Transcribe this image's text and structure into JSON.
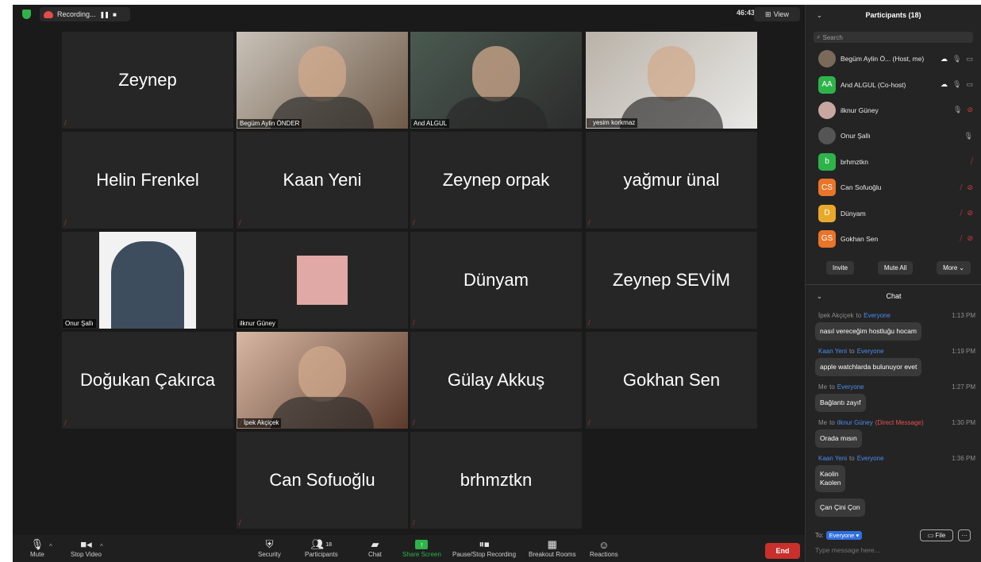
{
  "topbar": {
    "recording_label": "Recording...",
    "pause_glyph": "❚❚",
    "stop_glyph": "■",
    "timer": "46:43",
    "view_label": "View"
  },
  "tiles": [
    {
      "name": "Zeynep",
      "muted": true
    },
    {
      "name": "Begüm Aylin ÖNDER",
      "video": true
    },
    {
      "name": "And ALGUL",
      "video": true,
      "active": true
    },
    {
      "name": "yesim korkmaz",
      "video": true,
      "muted": true
    },
    {
      "name": "Helin Frenkel",
      "muted": true
    },
    {
      "name": "Kaan Yeni",
      "muted": true
    },
    {
      "name": "Zeynep orpak",
      "muted": true
    },
    {
      "name": "yağmur ünal",
      "muted": true
    },
    {
      "name": "Onur Şallı",
      "video": true
    },
    {
      "name": "ilknur Güney",
      "video": true
    },
    {
      "name": "Dünyam",
      "muted": true
    },
    {
      "name": "Zeynep SEVİM",
      "muted": true
    },
    {
      "name": "Doğukan Çakırca",
      "muted": true
    },
    {
      "name": "İpek Akçiçek",
      "video": true,
      "muted": true
    },
    {
      "name": "Gülay Akkuş",
      "muted": true
    },
    {
      "name": "Gokhan Sen",
      "muted": true
    },
    {
      "name": "Can Sofuoğlu",
      "muted": true
    },
    {
      "name": "brhmztkn",
      "muted": true
    }
  ],
  "toolbar": {
    "mute": "Mute",
    "stop_video": "Stop Video",
    "security": "Security",
    "participants": "Participants",
    "participants_count": "18",
    "chat": "Chat",
    "share_screen": "Share Screen",
    "pause_stop_recording": "Pause/Stop Recording",
    "breakout_rooms": "Breakout Rooms",
    "reactions": "Reactions",
    "end": "End"
  },
  "participants_panel": {
    "title": "Participants (18)",
    "search_placeholder": "Search",
    "list": [
      {
        "name": "Begüm Aylin Ö... (Host, me)",
        "avatar_text": "",
        "avatar_color": "#7a6a5a",
        "icons": [
          "cloud",
          "mic",
          "cam"
        ]
      },
      {
        "name": "And ALGUL (Co-host)",
        "avatar_text": "AA",
        "avatar_color": "#2eb34a",
        "icons": [
          "cloud",
          "mic",
          "cam"
        ]
      },
      {
        "name": "ilknur Güney",
        "avatar_text": "",
        "avatar_color": "#c9a7a0",
        "icons": [
          "mic",
          "cam-off"
        ]
      },
      {
        "name": "Onur Şallı",
        "avatar_text": "",
        "avatar_color": "#555555",
        "icons": [
          "mic"
        ]
      },
      {
        "name": "brhmztkn",
        "avatar_text": "b",
        "avatar_color": "#2eb34a",
        "icons": [
          "mic-off"
        ]
      },
      {
        "name": "Can Sofuoğlu",
        "avatar_text": "CS",
        "avatar_color": "#e8752a",
        "icons": [
          "mic-off",
          "cam-off"
        ]
      },
      {
        "name": "Dünyam",
        "avatar_text": "D",
        "avatar_color": "#e8a92a",
        "icons": [
          "mic-off",
          "cam-off"
        ]
      },
      {
        "name": "Gokhan Sen",
        "avatar_text": "GS",
        "avatar_color": "#e8752a",
        "icons": [
          "mic-off",
          "cam-off"
        ]
      }
    ],
    "invite": "Invite",
    "mute_all": "Mute All",
    "more": "More"
  },
  "chat": {
    "title": "Chat",
    "messages": [
      {
        "from": "İpek Akçiçek",
        "to_word": "to",
        "to": "Everyone",
        "dm": "",
        "time": "1:13 PM",
        "text": "nasıl vereceğim hostluğu hocam"
      },
      {
        "from": "Kaan Yeni",
        "to_word": "to",
        "to": "Everyone",
        "dm": "",
        "time": "1:19 PM",
        "text": "apple watchlarda bulunuyor evet"
      },
      {
        "from": "Me",
        "to_word": "to",
        "to": "Everyone",
        "dm": "",
        "time": "1:27 PM",
        "text": "Bağlantı zayıf"
      },
      {
        "from": "Me",
        "to_word": "to",
        "to": "ilknur Güney",
        "dm": "(Direct Message)",
        "time": "1:30 PM",
        "text": "Orada mısın"
      },
      {
        "from": "Kaan Yeni",
        "to_word": "to",
        "to": "Everyone",
        "dm": "",
        "time": "1:36 PM",
        "text": "Kaolin\nKaolen"
      }
    ],
    "last_text": "Çan Çini Çon",
    "to_label": "To:",
    "to_value": "Everyone",
    "file_label": "File",
    "input_placeholder": "Type message here..."
  }
}
